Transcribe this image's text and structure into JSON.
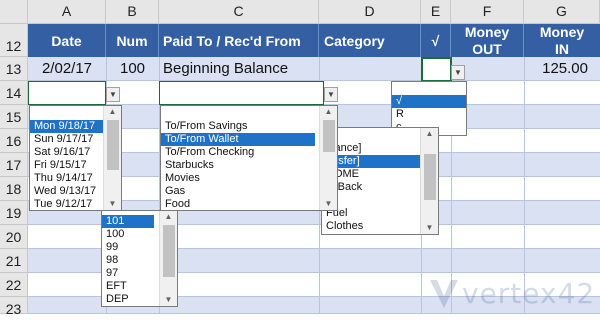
{
  "columns": [
    "A",
    "B",
    "C",
    "D",
    "E",
    "F",
    "G"
  ],
  "rows": [
    "12",
    "13",
    "14",
    "15",
    "16",
    "17",
    "18",
    "19",
    "20",
    "21",
    "22",
    "23"
  ],
  "header": {
    "date": "Date",
    "num": "Num",
    "paid": "Paid To / Rec'd From",
    "category": "Category",
    "check": "√",
    "money_out_1": "Money",
    "money_out_2": "OUT",
    "money_in_1": "Money",
    "money_in_2": "IN"
  },
  "row13": {
    "date": "2/02/17",
    "num": "100",
    "paid": "Beginning Balance",
    "money_in": "125.00"
  },
  "date_list": [
    "Mon 9/18/17",
    "Sun 9/17/17",
    "Sat 9/16/17",
    "Fri 9/15/17",
    "Thu 9/14/17",
    "Wed 9/13/17",
    "Tue 9/12/17"
  ],
  "num_list": [
    "101",
    "100",
    "99",
    "98",
    "97",
    "EFT",
    "DEP"
  ],
  "paid_list": [
    "To/From Savings",
    "To/From Wallet",
    "To/From Checking",
    "Starbucks",
    "Movies",
    "Gas",
    "Food"
  ],
  "category_list": [
    "alance]",
    "ansfer]",
    "COME",
    "id Back",
    "od",
    "Fuel",
    "Clothes"
  ],
  "check_list": [
    "√",
    "R",
    "c"
  ],
  "watermark": "vertex42",
  "colors": {
    "header_blue": "#355fa3",
    "band_blue": "#d9e1f2",
    "selection": "#1e73c8"
  }
}
